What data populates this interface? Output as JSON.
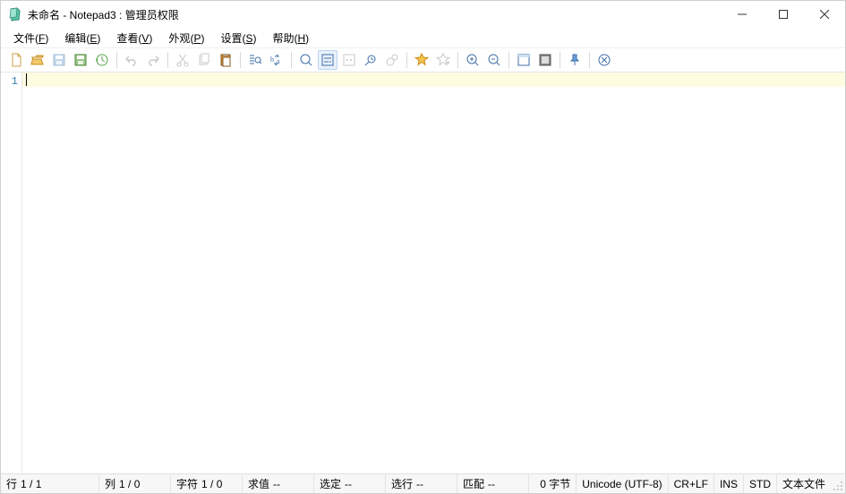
{
  "titlebar": {
    "text": "未命名 - Notepad3 : 管理员权限"
  },
  "menu": {
    "file": {
      "label": "文件",
      "key": "F"
    },
    "edit": {
      "label": "编辑",
      "key": "E"
    },
    "view": {
      "label": "查看",
      "key": "V"
    },
    "appearance": {
      "label": "外观",
      "key": "P"
    },
    "settings": {
      "label": "设置",
      "key": "S"
    },
    "help": {
      "label": "帮助",
      "key": "H"
    }
  },
  "editor": {
    "line_number": "1",
    "content": ""
  },
  "status": {
    "line": {
      "label": "行",
      "value": "1 / 1"
    },
    "col": {
      "label": "列",
      "value": "1 / 0"
    },
    "char": {
      "label": "字符",
      "value": "1 / 0"
    },
    "eval": {
      "label": "求值",
      "value": "--"
    },
    "selection": {
      "label": "选定",
      "value": "--"
    },
    "sel_lines": {
      "label": "选行",
      "value": "--"
    },
    "match": {
      "label": "匹配",
      "value": "--"
    },
    "size": {
      "label": "0 字节"
    },
    "encoding": {
      "label": "Unicode (UTF-8)"
    },
    "eol": {
      "label": "CR+LF"
    },
    "insert_mode": {
      "label": "INS"
    },
    "std": {
      "label": "STD"
    },
    "filetype": {
      "label": "文本文件"
    }
  }
}
